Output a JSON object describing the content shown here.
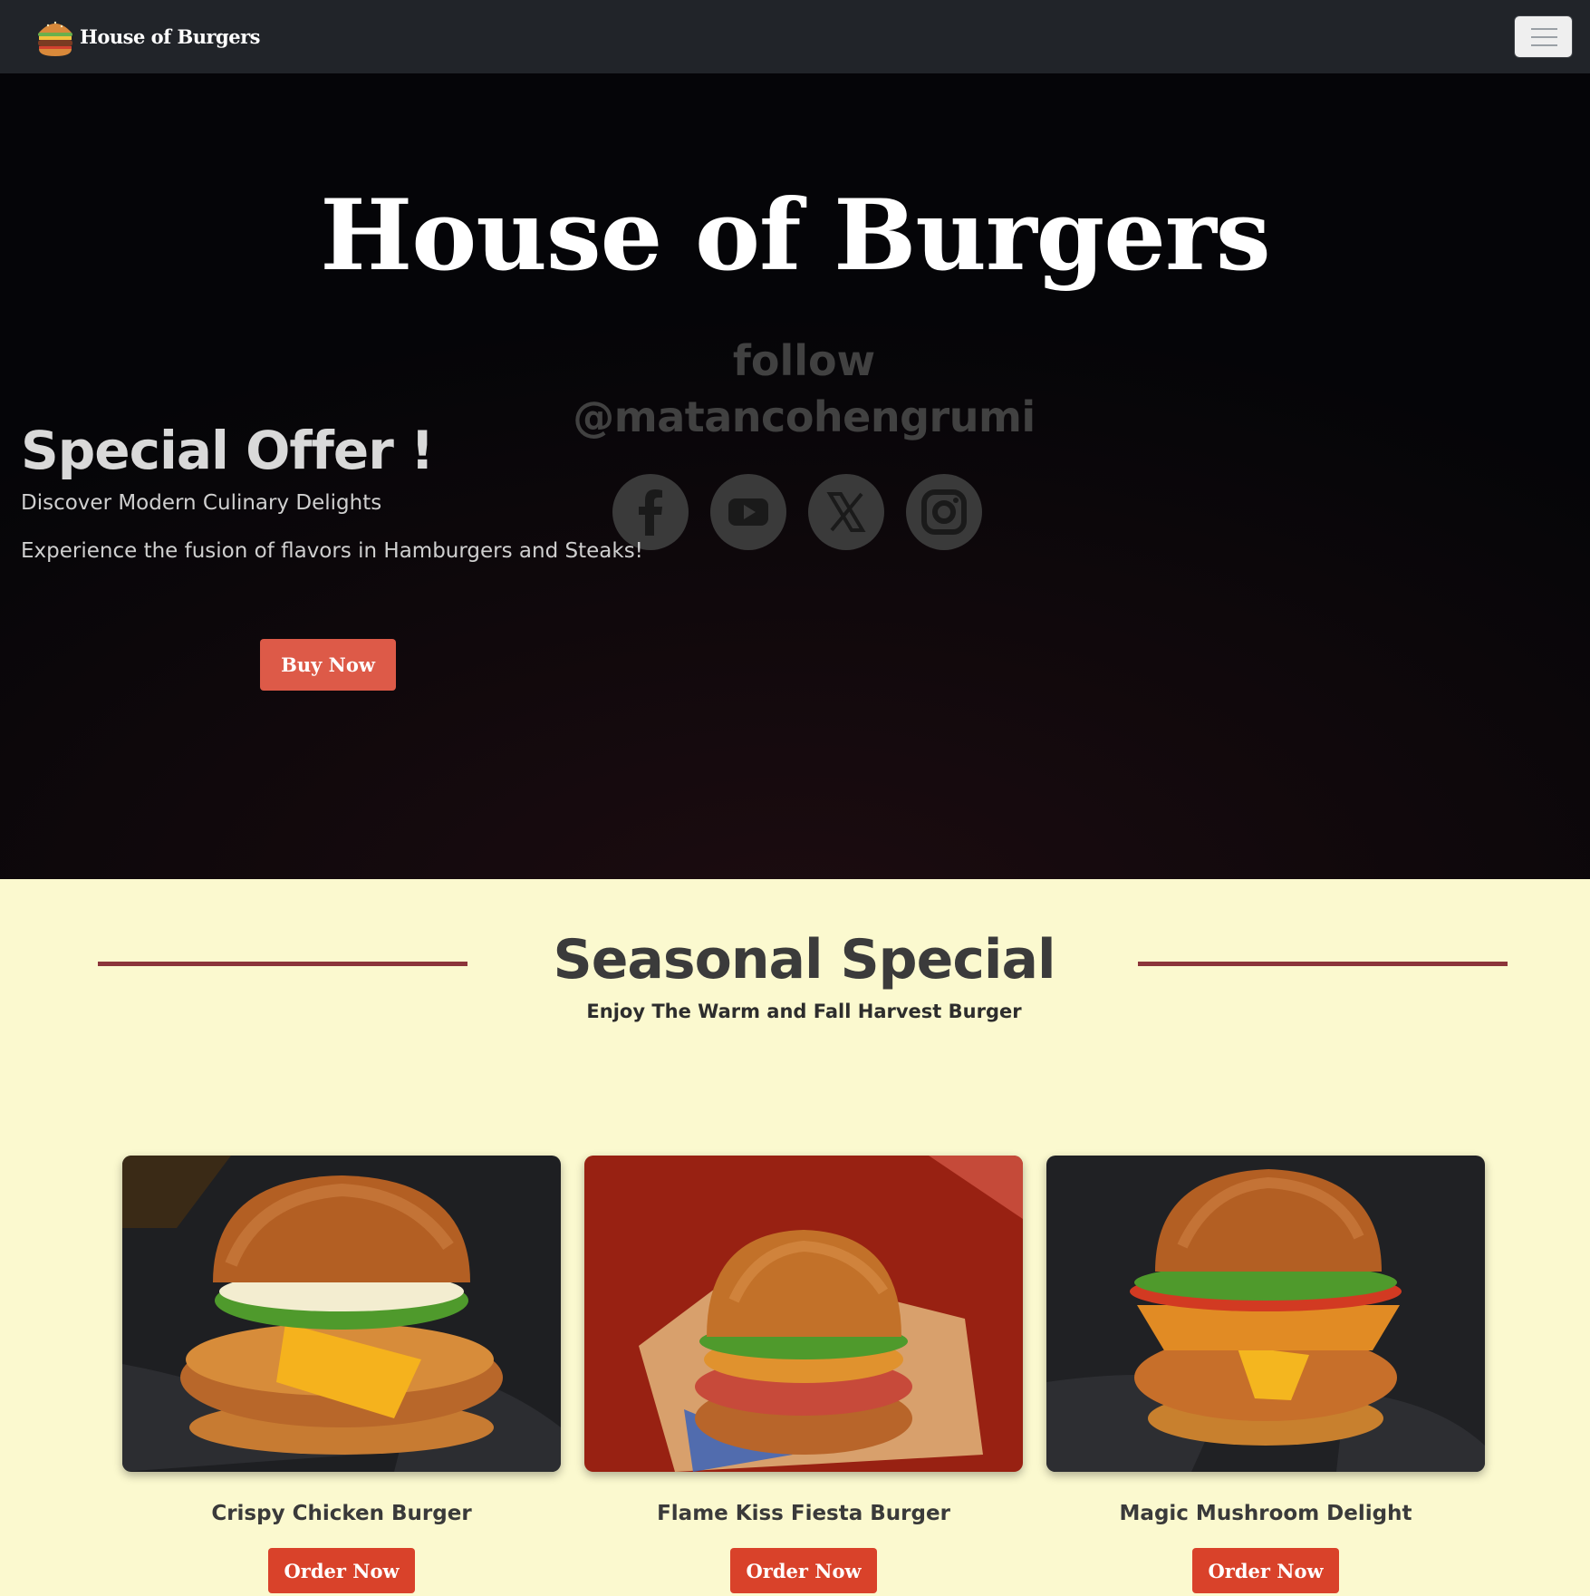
{
  "navbar": {
    "brand": "House of Burgers",
    "logo_icon": "burger-icon",
    "menu_icon": "hamburger-menu-icon"
  },
  "hero": {
    "title": "House of Burgers",
    "follow_line1": "follow",
    "follow_line2": "@matancohengrumi",
    "socials": [
      "facebook-icon",
      "youtube-icon",
      "x-icon",
      "instagram-icon"
    ],
    "offer_title": "Special Offer !",
    "offer_subtitle": "Discover Modern Culinary Delights",
    "offer_description": "Experience the fusion of flavors in Hamburgers and Steaks!",
    "buy_label": "Buy Now"
  },
  "seasonal": {
    "title": "Seasonal Special",
    "subtitle": "Enjoy The Warm and Fall Harvest Burger",
    "items": [
      {
        "name": "Crispy Chicken Burger",
        "button": "Order Now"
      },
      {
        "name": "Flame Kiss Fiesta Burger",
        "button": "Order Now"
      },
      {
        "name": "Magic Mushroom Delight",
        "button": "Order Now"
      }
    ]
  },
  "colors": {
    "navbar_bg": "#212429",
    "hero_bg": "#050508",
    "page_bg": "#fbf9cf",
    "accent": "#dd5a48",
    "order_button": "#d9422a",
    "rule": "#8b353a"
  }
}
